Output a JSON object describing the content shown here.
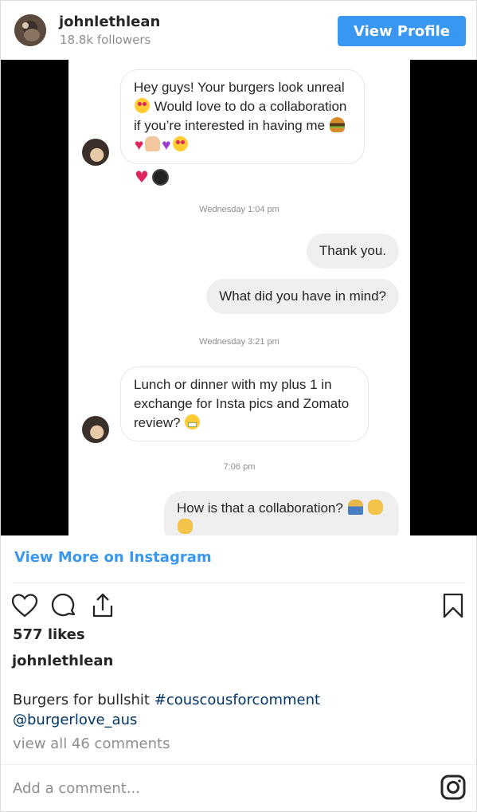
{
  "header": {
    "username": "johnlethlean",
    "followers": "18.8k followers",
    "view_profile_label": "View Profile"
  },
  "media": {
    "messages": [
      {
        "type": "in",
        "text": "Hey guys! Your burgers look unreal",
        "cont1": "Would love to do a collaboration if you’re interested in having me"
      },
      {
        "type": "time",
        "text": "Wednesday 1:04 pm"
      },
      {
        "type": "out",
        "text": "Thank you."
      },
      {
        "type": "out",
        "text": "What did you have in mind?"
      },
      {
        "type": "time",
        "text": "Wednesday 3:21 pm"
      },
      {
        "type": "in",
        "text": "Lunch or dinner with my plus 1 in exchange for Insta pics and Zomato review?"
      },
      {
        "type": "time",
        "text": "7:06 pm"
      },
      {
        "type": "out",
        "text": "How is that a collaboration?"
      }
    ]
  },
  "actions": {
    "view_more_label": "View More on Instagram",
    "likes": "577 likes"
  },
  "post": {
    "author": "johnlethlean",
    "caption_text": "Burgers for bullshit",
    "hashtag": "#couscousforcomment",
    "mention": "@burgerlove_aus",
    "view_comments": "view all 46 comments"
  },
  "comment": {
    "placeholder": "Add a comment..."
  },
  "icons": [
    "heart-icon",
    "comment-icon",
    "share-icon",
    "bookmark-icon",
    "instagram-icon"
  ],
  "colors": {
    "accent": "#3897f0",
    "hashtag": "#003569",
    "muted": "#8e8e8e"
  }
}
